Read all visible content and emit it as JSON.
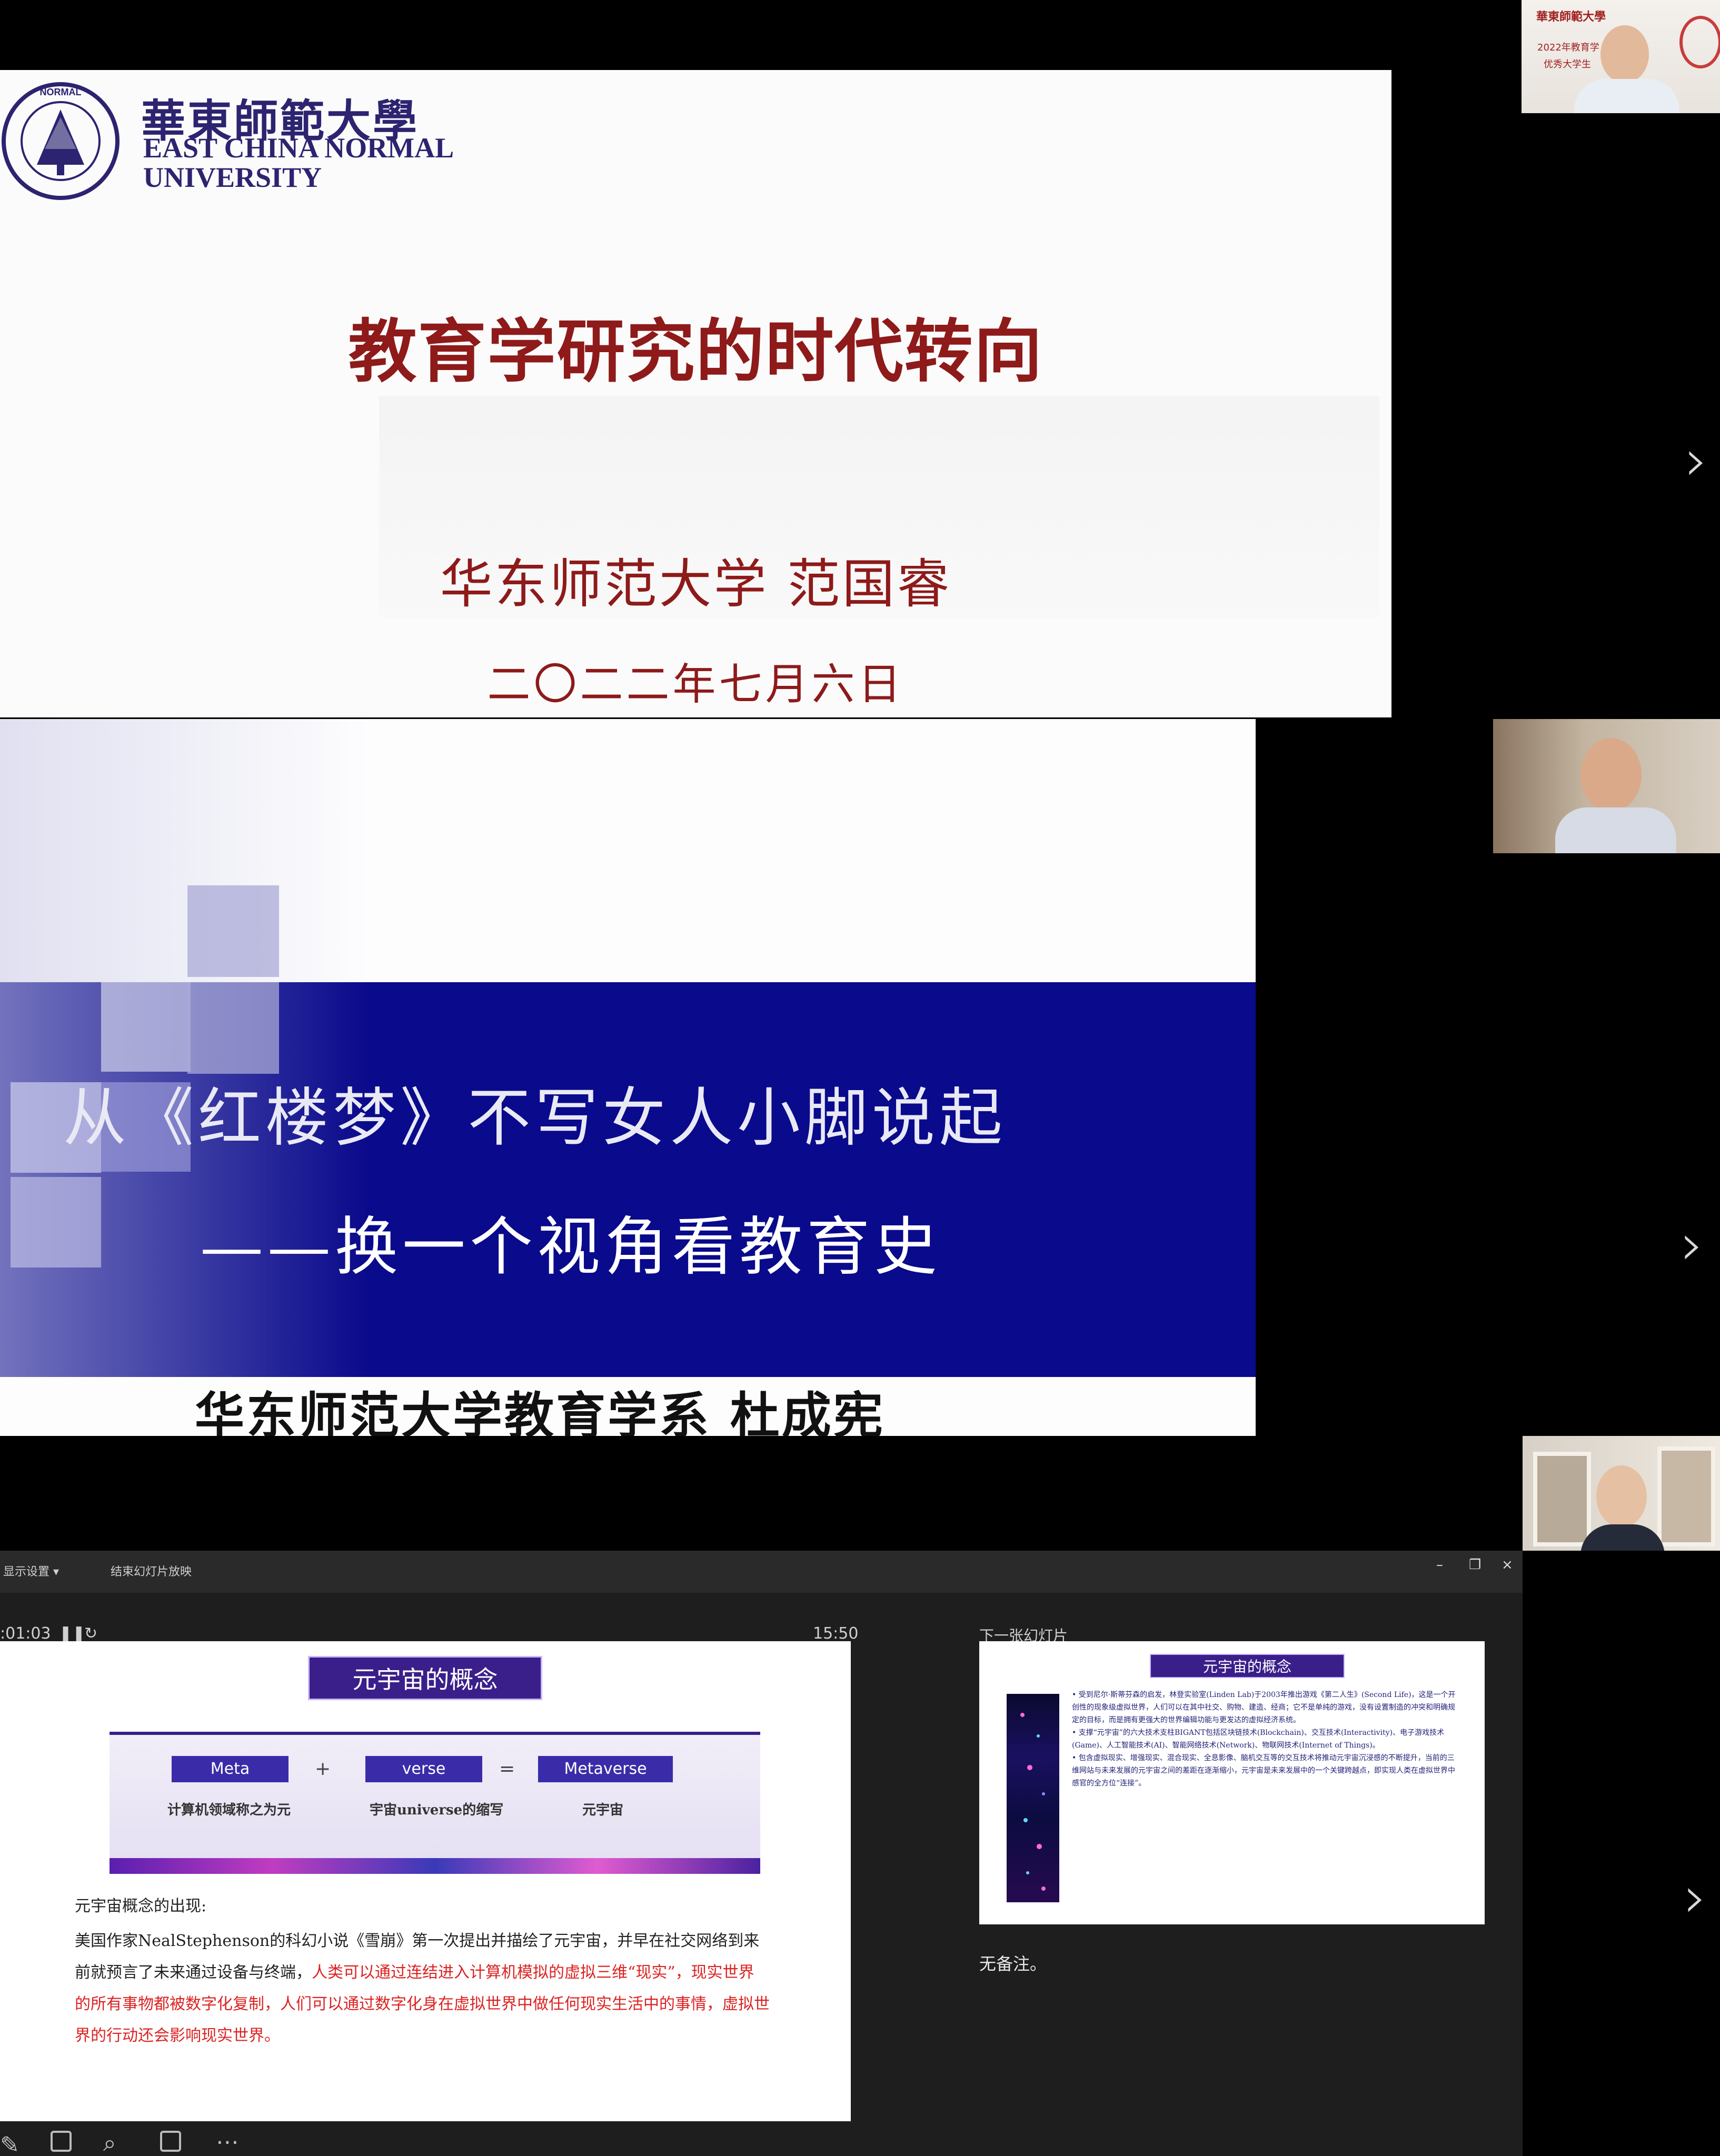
{
  "slide1": {
    "logo_cn": "華東師範大學",
    "logo_en_line1": "EAST CHINA NORMAL",
    "logo_en_line2": "UNIVERSITY",
    "title": "教育学研究的时代转向",
    "author": "华东师范大学  范国睿",
    "date": "二〇二二年七月六日"
  },
  "slide2": {
    "title": "从《红楼梦》不写女人小脚说起",
    "subtitle": "——换一个视角看教育史",
    "author": "华东师范大学教育学系  杜成宪"
  },
  "presenter": {
    "toolbar": {
      "display_settings": "显示设置 ▾",
      "end_slideshow": "结束幻灯片放映"
    },
    "elapsed_time": ":01:03",
    "pause_icon": "pause-icon",
    "restart_icon": "restart-icon",
    "clock": "15:50",
    "next_slide_label": "下一张幻灯片",
    "notes": "无备注。",
    "current_slide": {
      "title": "元宇宙的概念",
      "meta": "Meta",
      "plus": "+",
      "verse": "verse",
      "equals": "=",
      "metaverse": "Metaverse",
      "meta_caption": "计算机领域称之为元",
      "verse_caption": "宇宙universe的缩写",
      "metaverse_caption": "元宇宙",
      "heading": "元宇宙概念的出现:",
      "body_plain": "美国作家NealStephenson的科幻小说《雪崩》第一次提出并描绘了元宇宙，并早在社交网络到来前就预言了未来通过设备与终端，",
      "body_red": "人类可以通过连结进入计算机模拟的虚拟三维“现实”，现实世界的所有事物都被数字化复制，人们可以通过数字化身在虚拟世界中做任何现实生活中的事情，虚拟世界的行动还会影响现实世界。"
    },
    "next_slide": {
      "title": "元宇宙的概念",
      "bullet1": "• 受到尼尔·斯蒂芬森的启发，林登实验室(Linden Lab)于2003年推出游戏《第二人生》(Second Life)，这是一个开创性的现象级虚拟世界，人们可以在其中社交、购物、建造、经商；它不是单纯的游戏，没有设置制造的冲突和明确规定的目标，而是拥有更强大的世界编辑功能与更发达的虚拟经济系统。",
      "bullet2": "• 支撑“元宇宙”的六大技术支柱BIGANT包括区块链技术(Blockchain)、交互技术(Interactivity)、电子游戏技术(Game)、人工智能技术(AI)、智能网络技术(Network)、物联网技术(Internet of Things)。",
      "bullet3": "• 包含虚拟现实、增强现实、混合现实、全息影像、脑机交互等的交互技术将推动元宇宙沉浸感的不断提升，当前的三维网站与未来发展的元宇宙之间的差距在逐渐缩小，元宇宙是未来发展中的一个关键跨越点，即实现人类在虚拟世界中感官的全方位“连接”。"
    }
  },
  "video_tiles": [
    {
      "label_top": "華東師範大學",
      "label_mid": "2022年教育学",
      "label_bot": "优秀大学生"
    },
    {},
    {}
  ],
  "colors": {
    "ecnu_purple": "#2c2470",
    "slide_red": "#8e1a1a",
    "band_blue": "#0a0a8c",
    "meta_purple": "#3a1f8a"
  },
  "icons": [
    "chevron-right-icon",
    "pen-icon",
    "slides-grid-icon",
    "search-icon",
    "subtitle-icon",
    "more-icon"
  ]
}
